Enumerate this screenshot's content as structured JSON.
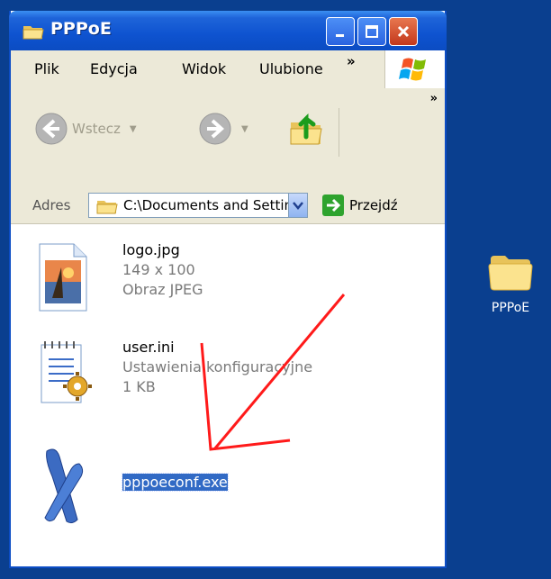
{
  "window": {
    "title": "PPPoE",
    "controls": {
      "minimize": "minimize",
      "maximize": "maximize",
      "close": "close"
    }
  },
  "menu": {
    "items": [
      "Plik",
      "Edycja",
      "Widok",
      "Ulubione"
    ],
    "overflow": "»"
  },
  "toolbar": {
    "back_label": "Wstecz",
    "overflow": "»"
  },
  "address": {
    "label": "Adres",
    "path": "C:\\Documents and Settings",
    "go_label": "Przejdź"
  },
  "files": [
    {
      "name": "logo.jpg",
      "line2": "149 x 100",
      "line3": "Obraz JPEG",
      "icon": "jpeg-image-icon"
    },
    {
      "name": "user.ini",
      "line2": "Ustawienia konfiguracyjne",
      "line3": "1 KB",
      "icon": "config-file-icon"
    },
    {
      "name": "pppoeconf.exe",
      "icon": "pppoeconf-app-icon",
      "selected": true
    }
  ],
  "desktop": {
    "icon_label": "PPPoE",
    "background": "#0a3f8f"
  },
  "colors": {
    "selection": "#316ac5",
    "annotation_arrow": "#ff1a1a",
    "titlebar": "#0e53d0"
  }
}
